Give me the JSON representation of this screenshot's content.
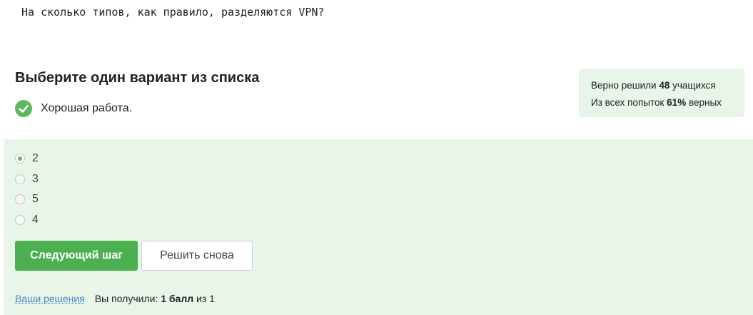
{
  "question": "На сколько типов, как правило, разделяются VPN?",
  "quiz": {
    "title": "Выберите один вариант из списка",
    "feedback": "Хорошая работа.",
    "check_icon": "check-circle-icon"
  },
  "stats": {
    "line1_prefix": "Верно решили",
    "line1_value": "48",
    "line1_suffix": "учащихся",
    "line2_prefix": "Из всех попыток",
    "line2_value": "61%",
    "line2_suffix": "верных"
  },
  "options": [
    {
      "label": "2",
      "selected": true
    },
    {
      "label": "3",
      "selected": false
    },
    {
      "label": "5",
      "selected": false
    },
    {
      "label": "4",
      "selected": false
    }
  ],
  "buttons": {
    "next": "Следующий шаг",
    "retry": "Решить снова"
  },
  "footer": {
    "solutions_link": "Ваши решения",
    "score_prefix": "Вы получили:",
    "score_value": "1 балл",
    "score_middle": "из",
    "score_max": "1"
  },
  "colors": {
    "accent": "#4caf50",
    "panel_bg": "#e9f5e9",
    "link": "#4a86c5"
  }
}
